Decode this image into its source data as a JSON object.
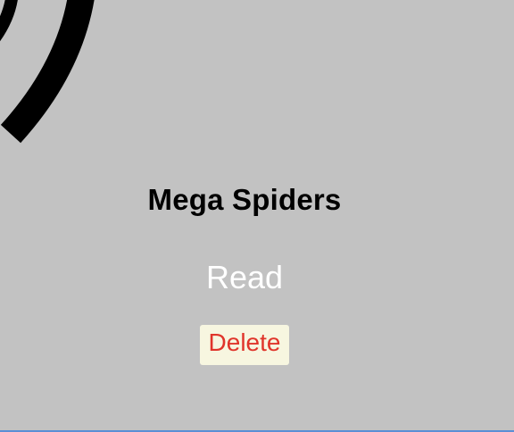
{
  "book": {
    "title": "Mega Spiders",
    "cover_icon": "spider-cover-image"
  },
  "actions": {
    "read_label": "Read",
    "delete_label": "Delete"
  },
  "colors": {
    "background": "#c2c2c2",
    "title_text": "#000000",
    "read_text": "#ffffff",
    "delete_text": "#e0352b",
    "delete_background": "#f7f6e0",
    "bottom_border": "#5b8fd6"
  }
}
